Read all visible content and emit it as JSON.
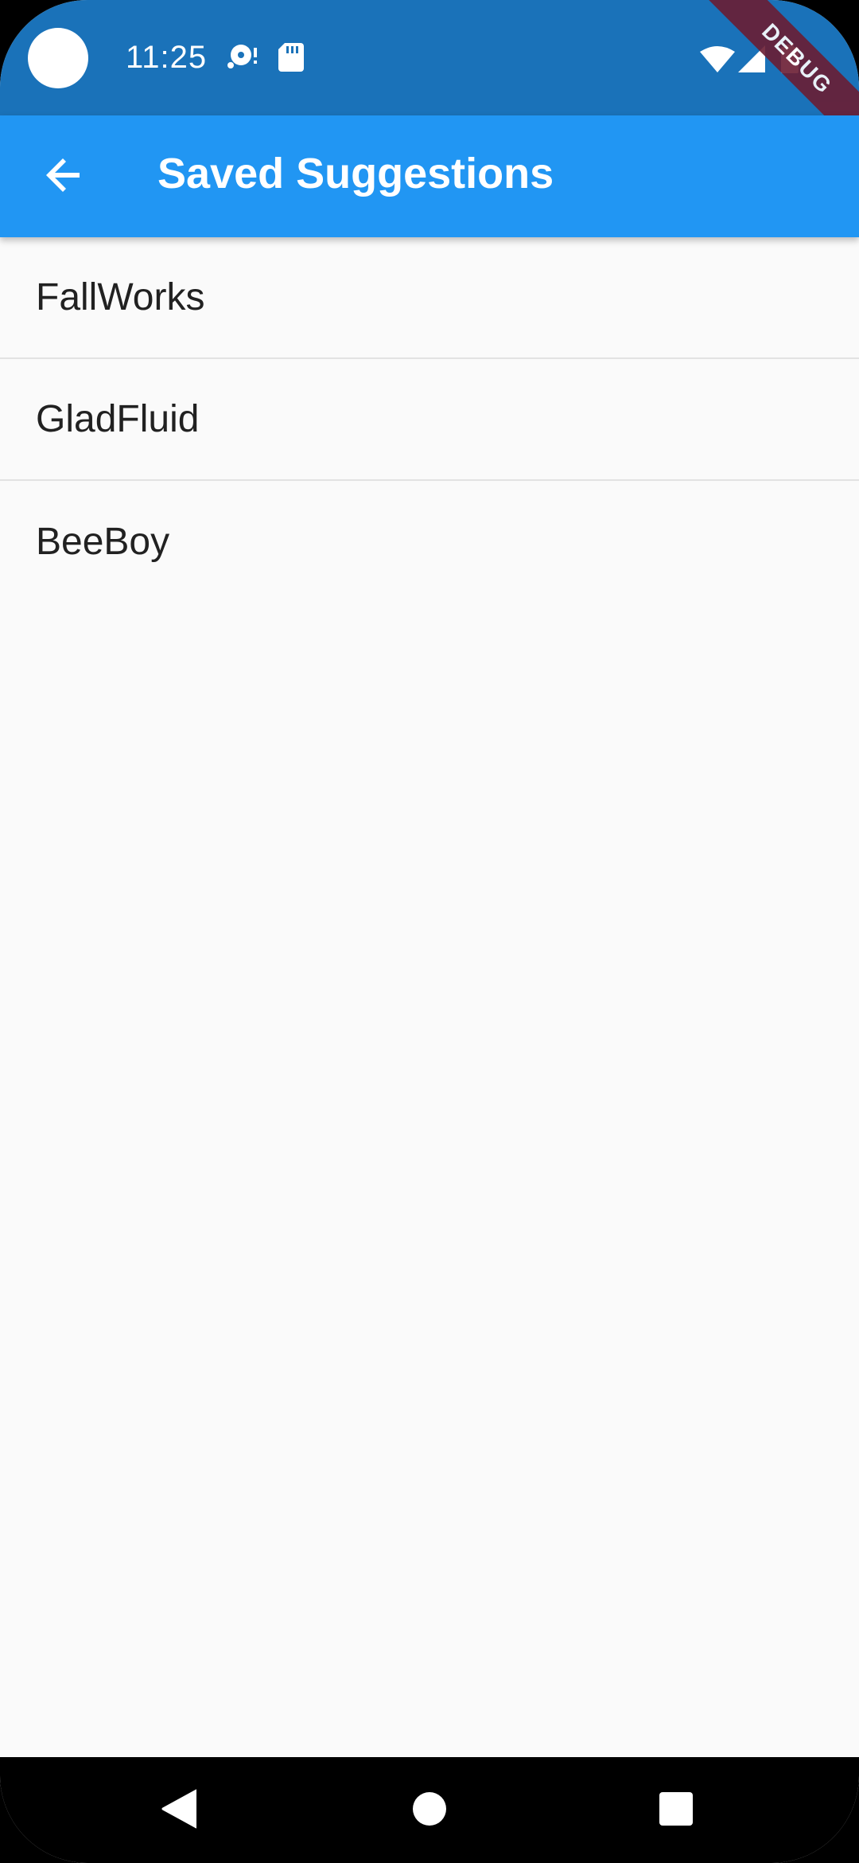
{
  "status_bar": {
    "time": "11:25",
    "icons": [
      "camera-cutout",
      "notification-icon",
      "sd-card-icon",
      "wifi-icon",
      "signal-icon",
      "battery-icon"
    ],
    "color": "#1a72b9"
  },
  "debug_banner": {
    "label": "DEBUG",
    "color": "#6b1d33"
  },
  "app_bar": {
    "title": "Saved Suggestions",
    "back_icon": "arrow-back-icon",
    "color": "#2196f3"
  },
  "suggestions": [
    {
      "label": "FallWorks"
    },
    {
      "label": "GladFluid"
    },
    {
      "label": "BeeBoy"
    }
  ],
  "navigation_bar": {
    "buttons": [
      "back-triangle-icon",
      "home-circle-icon",
      "recents-square-icon"
    ]
  }
}
